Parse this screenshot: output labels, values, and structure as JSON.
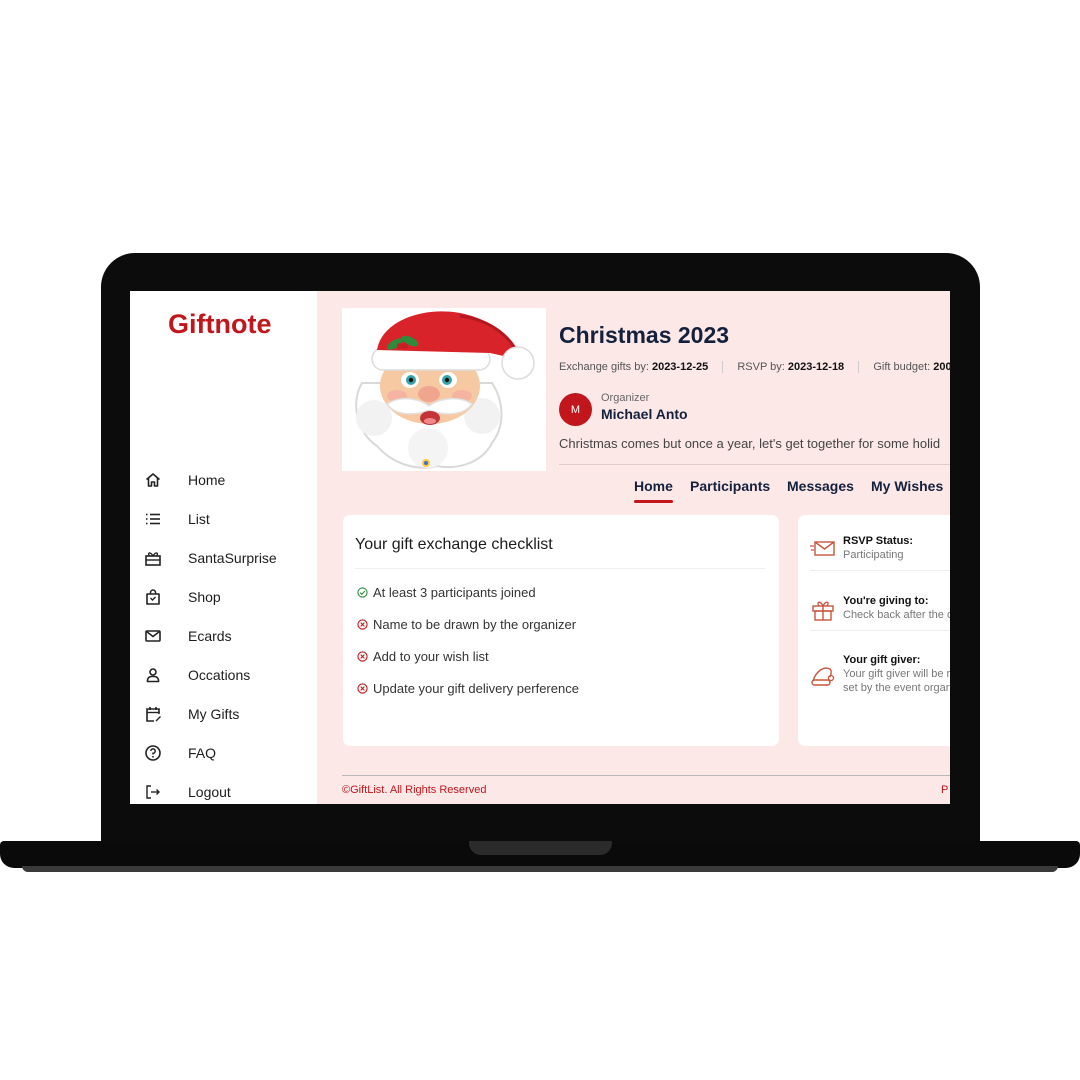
{
  "app": {
    "logo": "Giftnote"
  },
  "sidebar": {
    "items": [
      {
        "label": "Home",
        "icon": "home-icon"
      },
      {
        "label": "List",
        "icon": "list-icon"
      },
      {
        "label": "SantaSurprise",
        "icon": "gift-box-icon"
      },
      {
        "label": "Shop",
        "icon": "shopping-bag-icon"
      },
      {
        "label": "Ecards",
        "icon": "mail-icon"
      },
      {
        "label": "Occations",
        "icon": "user-icon"
      },
      {
        "label": "My Gifts",
        "icon": "calendar-edit-icon"
      },
      {
        "label": "FAQ",
        "icon": "question-icon"
      },
      {
        "label": "Logout",
        "icon": "logout-icon"
      }
    ]
  },
  "event": {
    "title": "Christmas 2023",
    "exchange_label": "Exchange gifts by: ",
    "exchange_date": "2023-12-25",
    "rsvp_label": "RSVP by: ",
    "rsvp_date": "2023-12-18",
    "budget_label": "Gift budget: ",
    "budget_value": "200",
    "organizer_label": "Organizer",
    "organizer_initial": "M",
    "organizer_name": "Michael Anto",
    "description": "Christmas comes but once a year, let's get together for some holid",
    "image_icon": "santa-claus-icon"
  },
  "tabs": [
    {
      "label": "Home",
      "active": true
    },
    {
      "label": "Participants",
      "active": false
    },
    {
      "label": "Messages",
      "active": false
    },
    {
      "label": "My Wishes",
      "active": false
    }
  ],
  "checklist": {
    "title": "Your gift exchange checklist",
    "items": [
      {
        "label": "At least 3 participants joined",
        "done": true
      },
      {
        "label": "Name to be drawn by the organizer",
        "done": false
      },
      {
        "label": "Add to your wish list",
        "done": false
      },
      {
        "label": "Update your gift delivery perference",
        "done": false
      }
    ]
  },
  "status": {
    "rsvp_title": "RSVP Status:",
    "rsvp_value": "Participating",
    "giving_title": "You're giving to:",
    "giving_value": "Check back after the d",
    "giver_title": "Your gift giver:",
    "giver_line1": "Your gift giver will be r",
    "giver_line2": "set by the event organ"
  },
  "footer": {
    "copyright": "©GiftList. All Rights Reserved",
    "right": "P"
  },
  "colors": {
    "accent": "#c0161c",
    "navy": "#14213d",
    "main_bg": "#fde8e8",
    "success": "#2e8b3d"
  }
}
